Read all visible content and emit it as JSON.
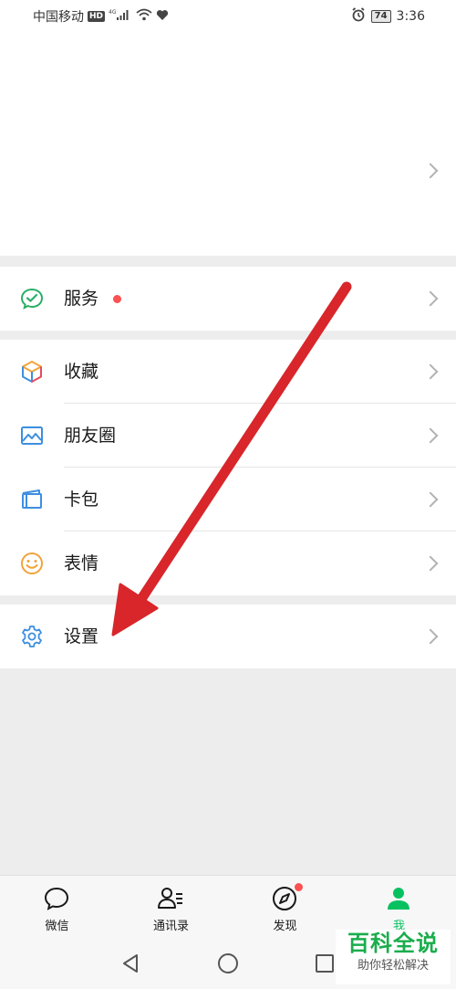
{
  "status_bar": {
    "carrier": "中国移动",
    "hd": "HD",
    "signal_type": "4G",
    "battery": "74",
    "time": "3:36"
  },
  "menu": {
    "services": {
      "label": "服务",
      "icon": "wechat-pay-icon"
    },
    "favorites": {
      "label": "收藏",
      "icon": "cube-icon"
    },
    "moments": {
      "label": "朋友圈",
      "icon": "image-icon"
    },
    "cards": {
      "label": "卡包",
      "icon": "wallet-icon"
    },
    "stickers": {
      "label": "表情",
      "icon": "smile-icon"
    },
    "settings": {
      "label": "设置",
      "icon": "gear-icon"
    }
  },
  "tabs": [
    {
      "label": "微信",
      "icon": "chat-bubble-icon",
      "active": false
    },
    {
      "label": "通讯录",
      "icon": "contacts-icon",
      "active": false
    },
    {
      "label": "发现",
      "icon": "compass-icon",
      "active": false,
      "badge": true
    },
    {
      "label": "我",
      "icon": "person-icon",
      "active": true
    }
  ],
  "watermark": {
    "title": "百科全说",
    "subtitle": "助你轻松解决"
  },
  "colors": {
    "accent_green": "#07c160",
    "badge_red": "#fa5151",
    "annotation_red": "#e02020"
  }
}
